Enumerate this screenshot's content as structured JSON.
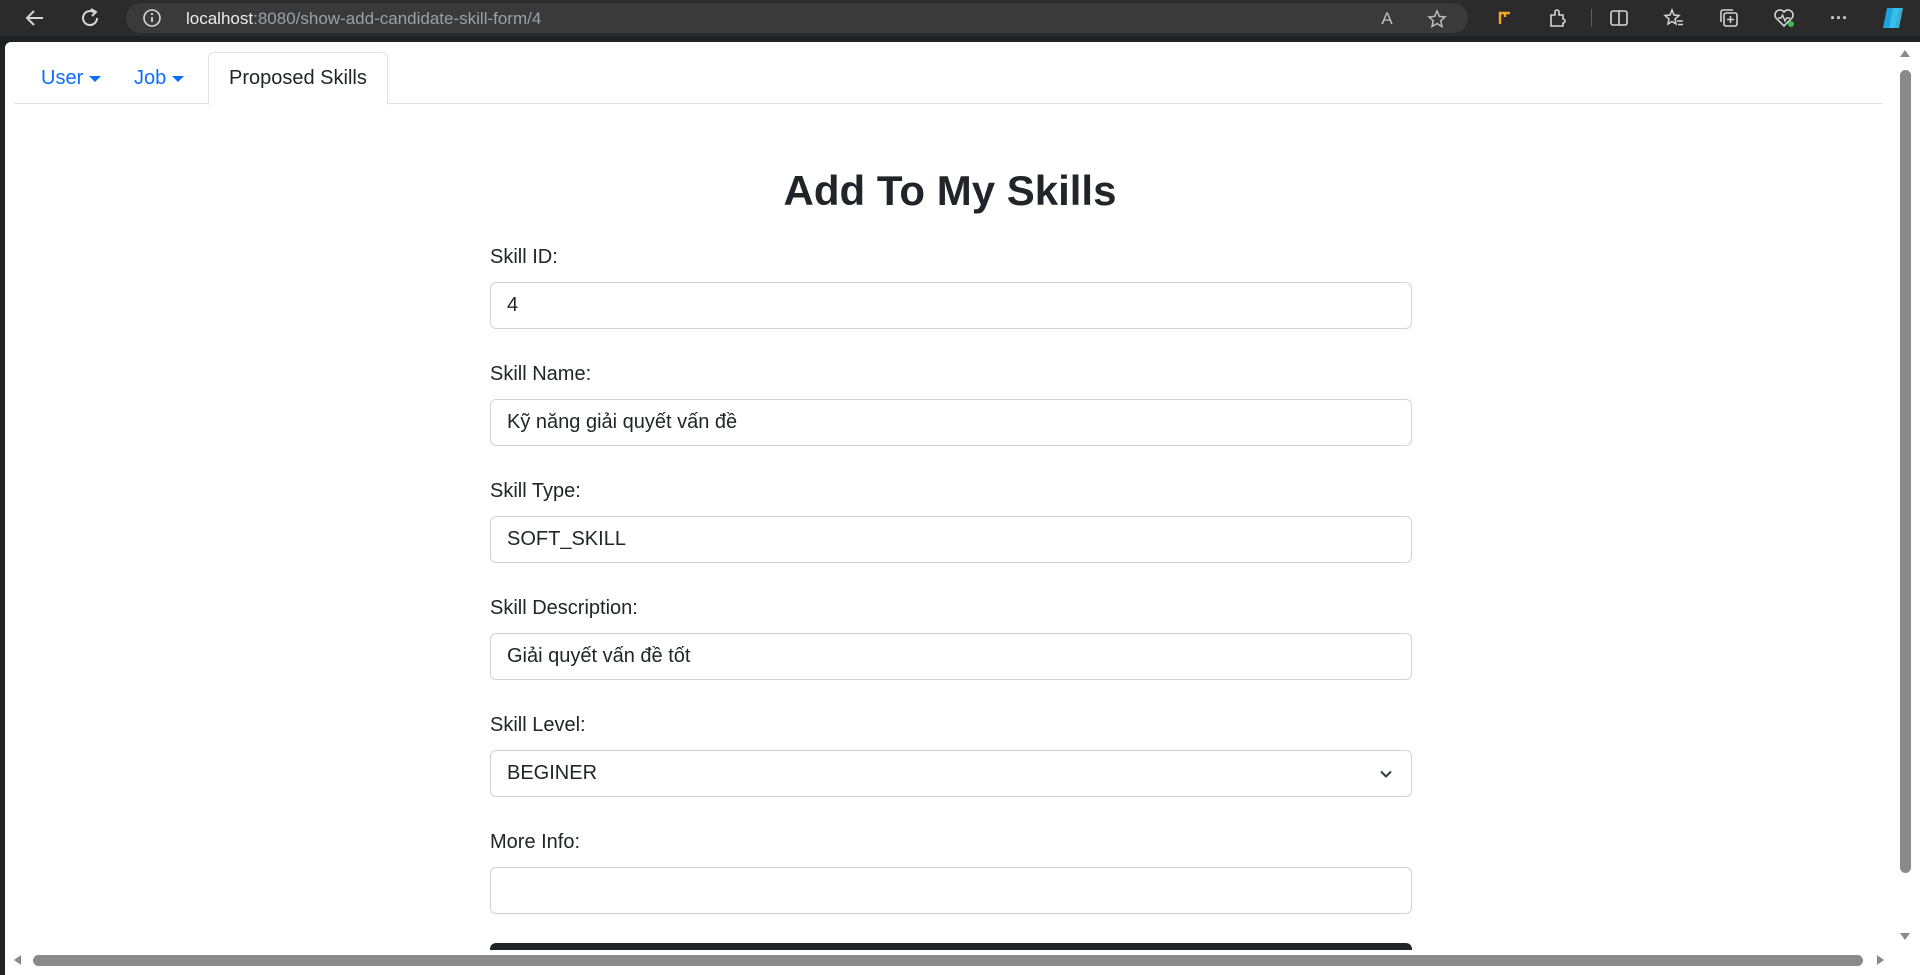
{
  "browser": {
    "url_host": "localhost",
    "url_path": ":8080/show-add-candidate-skill-form/4",
    "icons": [
      "back-icon",
      "reload-icon",
      "info-icon",
      "read-aloud-icon",
      "favorite-star-icon",
      "toolbar-extension-icon",
      "extensions-icon",
      "split-screen-icon",
      "favorites-icon",
      "collections-icon",
      "browser-essentials-icon",
      "more-icon",
      "copilot-icon"
    ],
    "read_aloud_glyph": "A",
    "more_glyph": "···"
  },
  "nav": {
    "tabs": [
      {
        "label": "User",
        "dropdown": true
      },
      {
        "label": "Job",
        "dropdown": true
      },
      {
        "label": "Proposed Skills",
        "active": true
      }
    ]
  },
  "form": {
    "title": "Add To My Skills",
    "fields": {
      "skill_id": {
        "label": "Skill ID:",
        "value": "4"
      },
      "skill_name": {
        "label": "Skill Name:",
        "value": "Kỹ năng giải quyết vấn đề"
      },
      "skill_type": {
        "label": "Skill Type:",
        "value": "SOFT_SKILL"
      },
      "skill_description": {
        "label": "Skill Description:",
        "value": "Giải quyết vấn đề tốt"
      },
      "skill_level": {
        "label": "Skill Level:",
        "value": "BEGINER"
      },
      "more_info": {
        "label": "More Info:",
        "value": ""
      }
    }
  },
  "colors": {
    "link": "#0d6efd",
    "text": "#212529",
    "border": "#ced4da",
    "button_dark": "#212529"
  }
}
